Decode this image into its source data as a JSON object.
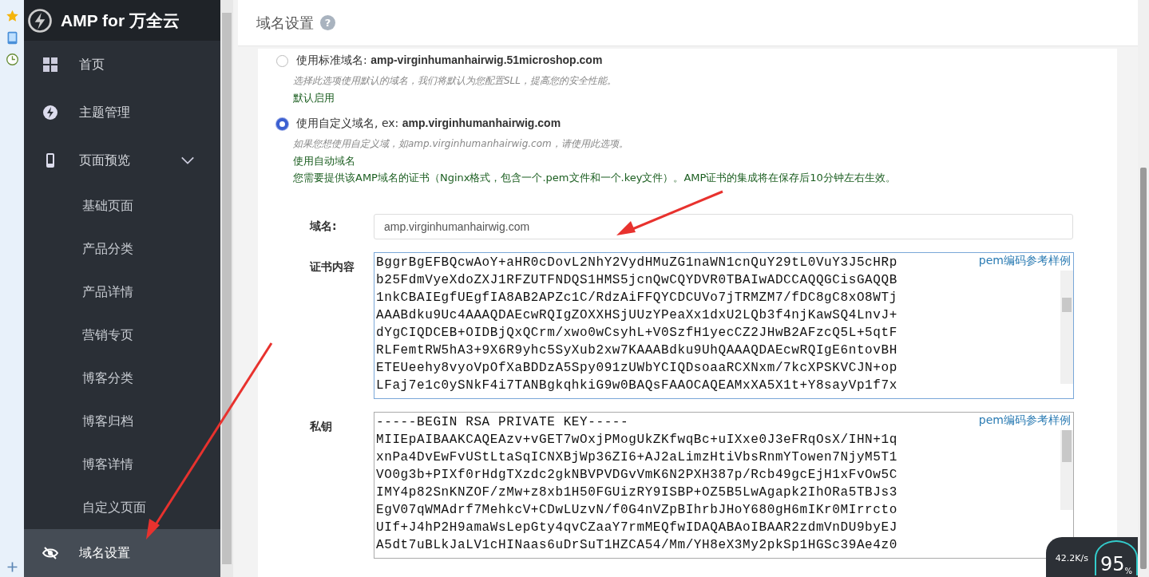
{
  "brand": {
    "title": "AMP for 万全云"
  },
  "sidebar": {
    "items": [
      {
        "label": "首页",
        "kind": "grid",
        "selected": false
      },
      {
        "label": "主题管理",
        "kind": "bolt",
        "selected": false
      },
      {
        "label": "页面预览",
        "kind": "phone",
        "selected": false,
        "expanded": true,
        "children": [
          {
            "label": "基础页面",
            "selected": false
          },
          {
            "label": "产品分类",
            "selected": false
          },
          {
            "label": "产品详情",
            "selected": false
          },
          {
            "label": "营销专页",
            "selected": false
          },
          {
            "label": "博客分类",
            "selected": false
          },
          {
            "label": "博客归档",
            "selected": false
          },
          {
            "label": "博客详情",
            "selected": false
          },
          {
            "label": "自定义页面",
            "selected": false
          }
        ]
      },
      {
        "label": "域名设置",
        "kind": "eye-off",
        "selected": true
      }
    ]
  },
  "header": {
    "title": "域名设置",
    "help": "?"
  },
  "options": [
    {
      "prefix": "使用标准域名: ",
      "domain": "amp-virginhumanhairwig.51microshop.com",
      "selected": false,
      "hint": "选择此选项使用默认的域名，我们将默认为您配置SLL，提高您的安全性能。",
      "notes": [
        "默认启用"
      ]
    },
    {
      "prefix": "使用自定义域名, ex: ",
      "domain": "amp.virginhumanhairwig.com",
      "selected": true,
      "hint": "如果您想使用自定义域，如amp.virginhumanhairwig.com，请使用此选项。",
      "notes": [
        "使用自动域名",
        "您需要提供该AMP域名的证书（Nginx格式，包含一个.pem文件和一个.key文件）。AMP证书的集成将在保存后10分钟左右生效。"
      ]
    }
  ],
  "form": {
    "domain_label": "域名:",
    "domain_value": "amp.virginhumanhairwig.com",
    "fields": [
      {
        "label": "证书内容",
        "link": "pem编码参考样例",
        "focused": true,
        "lines": [
          "BggrBgEFBQcwAoY+aHR0cDovL2NhY2VydHMuZG1naWN1cnQuY29tL0VuY3J5cHRp",
          "b25FdmVyeXdoZXJ1RFZUTFNDQS1HMS5jcnQwCQYDVR0TBAIwADCCAQQGCisGAQQB",
          "1nkCBAIEgfUEgfIA8AB2APZc1C/RdzAiFFQYCDCUVo7jTRMZM7/fDC8gC8xO8WTj",
          "AAABdku9Uc4AAAQDAEcwRQIgZOXXHSjUUzYPeaXx1dxU2LQb3f4njKawSQ4LnvJ+",
          "dYgCIQDCEB+OIDBjQxQCrm/xwo0wCsyhL+V0SzfH1yecCZ2JHwB2AFzcQ5L+5qtF",
          "RLFemtRW5hA3+9X6R9yhc5SyXub2xw7KAAABdku9UhQAAAQDAEcwRQIgE6ntovBH",
          "ETEUeehy8vyoVpOfXaBDDzA5Spy091zUWbYCIQDsoaaRCXNxm/7kcXPSKVCJN+op",
          "LFaj7e1c0ySNkF4i7TANBgkqhkiG9w0BAQsFAAOCAQEAMxXA5X1t+Y8sayVp1f7x"
        ]
      },
      {
        "label": "私钥",
        "link": "pem编码参考样例",
        "focused": false,
        "lines": [
          "-----BEGIN RSA PRIVATE KEY-----",
          "MIIEpAIBAAKCAQEAzv+vGET7wOxjPMogUkZKfwqBc+uIXxe0J3eFRqOsX/IHN+1q",
          "xnPa4DvEwFvUStLtaSqICNXBjWp36ZI6+AJ2aLimzHtiVbsRnmYTowen7NjyM5T1",
          "VO0g3b+PIXf0rHdgTXzdc2gkNBVPVDGvVmK6N2PXH387p/Rcb49gcEjH1xFvOw5C",
          "IMY4p82SnKNZOF/zMw+z8xb1H50FGUizRY9ISBP+OZ5B5LwAgapk2IhORa5TBJs3",
          "EgV07qWMAdrf7MehkcV+CDwLUzvN/f0G4nVZpBIhrbJHoY680gH6mIKr0MIrrcto",
          "UIf+J4hP2H9amaWsLepGty4qvCZaaY7rmMEQfwIDAQABAoIBAAR2zdmVnDU9byEJ",
          "A5dt7uBLkJaLV1cHINaas6uDrSuT1HZCA54/Mm/YH8eX3My2pkSp1HGSc39Ae4z0"
        ]
      }
    ]
  },
  "net_widget": {
    "speed": "42.2K/s",
    "percent": "95",
    "unit": "%"
  }
}
